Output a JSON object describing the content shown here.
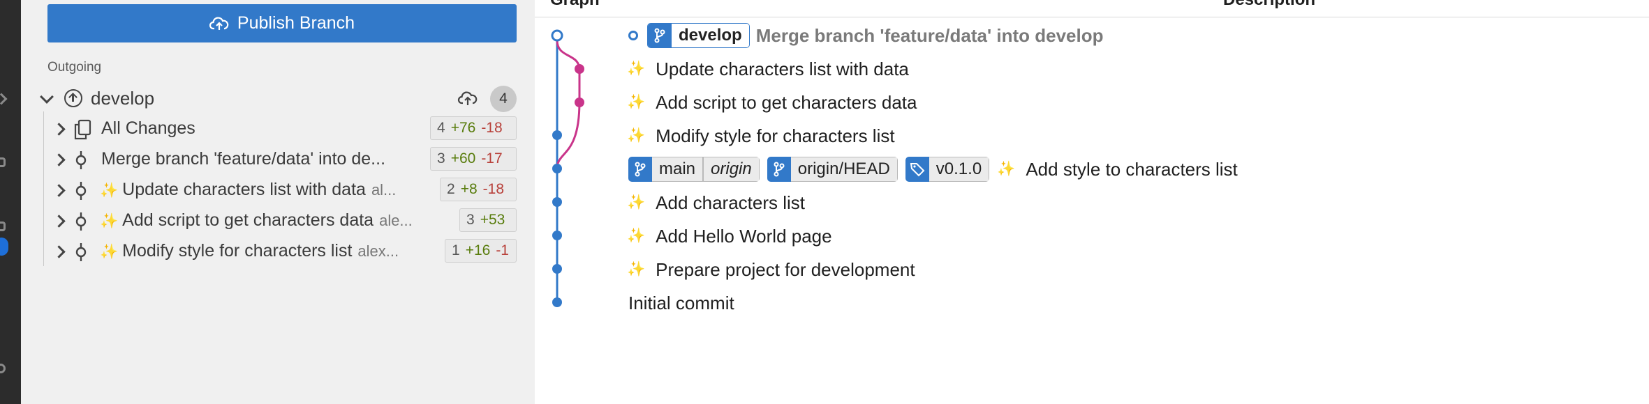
{
  "publish": {
    "label": "Publish Branch"
  },
  "outgoing": {
    "section_label": "Outgoing",
    "branch": "develop",
    "count": "4",
    "rows": [
      {
        "icon": "files-icon",
        "text": "All Changes",
        "author": "",
        "files": "4",
        "additions": "+76",
        "deletions": "-18"
      },
      {
        "icon": "commit-icon",
        "sparkle": false,
        "text": "Merge branch 'feature/data' into de...",
        "author": "",
        "files": "3",
        "additions": "+60",
        "deletions": "-17"
      },
      {
        "icon": "commit-icon",
        "sparkle": true,
        "text": "Update characters list with data",
        "author": "al...",
        "files": "2",
        "additions": "+8",
        "deletions": "-18"
      },
      {
        "icon": "commit-icon",
        "sparkle": true,
        "text": "Add script to get characters data",
        "author": "ale...",
        "files": "3",
        "additions": "+53",
        "deletions": ""
      },
      {
        "icon": "commit-icon",
        "sparkle": true,
        "text": "Modify style for characters list",
        "author": "alex...",
        "files": "1",
        "additions": "+16",
        "deletions": "-1"
      }
    ]
  },
  "graph": {
    "headers": {
      "graph": "Graph",
      "description": "Description"
    },
    "colors": {
      "main_lane": "#3279c9",
      "feature_lane": "#c9348a"
    },
    "commits": [
      {
        "refs": [
          {
            "type": "branch",
            "name": "develop",
            "active": true
          }
        ],
        "message": "Merge branch 'feature/data' into develop"
      },
      {
        "sparkle": true,
        "message": "Update characters list with data"
      },
      {
        "sparkle": true,
        "message": "Add script to get characters data"
      },
      {
        "sparkle": true,
        "message": "Modify style for characters list"
      },
      {
        "refs": [
          {
            "type": "branch",
            "name": "main",
            "remote": "origin"
          },
          {
            "type": "branch",
            "name": "origin/HEAD"
          },
          {
            "type": "tag",
            "name": "v0.1.0"
          }
        ],
        "sparkle": true,
        "message": "Add style to characters list"
      },
      {
        "sparkle": true,
        "message": "Add characters list"
      },
      {
        "sparkle": true,
        "message": "Add Hello World page"
      },
      {
        "sparkle": true,
        "message": "Prepare project for development"
      },
      {
        "sparkle": false,
        "message": "Initial commit"
      }
    ],
    "sparkle_glyph": "✨"
  }
}
